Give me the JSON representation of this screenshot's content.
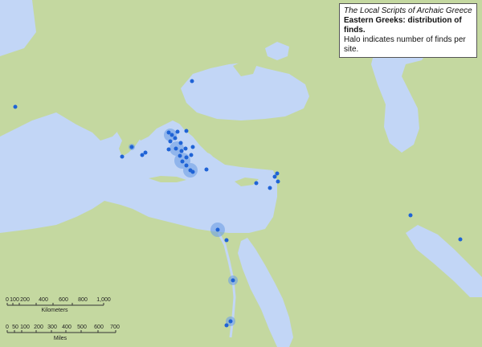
{
  "legend": {
    "title": "The Local Scripts of Archaic Greece",
    "subtitle": "Eastern Greeks: distribution of finds.",
    "note": "Halo indicates number of finds per site."
  },
  "colors": {
    "land": "#c4d8a0",
    "water": "#c2d6f6",
    "site": "#1f63d6",
    "halo": "#6fa0e6",
    "border": "#9ab090"
  },
  "scale": {
    "km_ticks": [
      "0",
      "100",
      "200",
      "400",
      "600",
      "800",
      "1,000"
    ],
    "km_label": "Kilometers",
    "mi_ticks": [
      "0",
      "50",
      "100",
      "200",
      "300",
      "400",
      "500",
      "600",
      "700"
    ],
    "mi_label": "Miles"
  }
}
